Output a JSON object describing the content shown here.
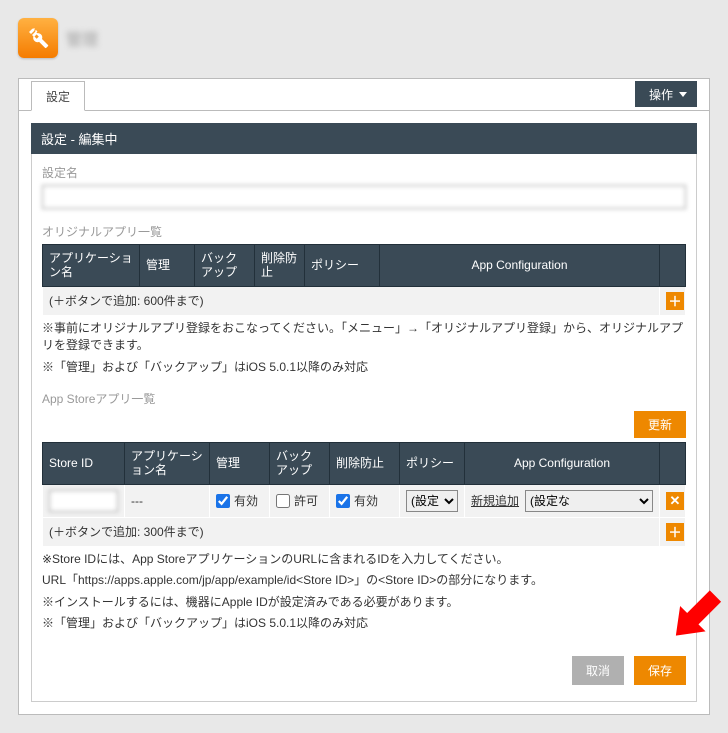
{
  "logo": {
    "text": "管理"
  },
  "tab": {
    "label": "設定"
  },
  "ops_button": {
    "label": "操作"
  },
  "title_bar": "設定 - 編集中",
  "setting_name": {
    "label": "設定名",
    "value": "　　　"
  },
  "original_apps": {
    "section_label": "オリジナルアプリ一覧",
    "headers": {
      "app_name": "アプリケーション名",
      "manage": "管理",
      "backup": "バックアップ",
      "prevent_delete": "削除防止",
      "policy": "ポリシー",
      "app_config": "App Configuration",
      "action": ""
    },
    "add_hint": "(＋ボタンで追加: 600件まで)",
    "notes": [
      "※事前にオリジナルアプリ登録をおこなってください。「メニュー」→「オリジナルアプリ登録」から、オリジナルアプリを登録できます。",
      "※「管理」および「バックアップ」はiOS 5.0.1以降のみ対応"
    ]
  },
  "appstore_apps": {
    "section_label": "App Storeアプリ一覧",
    "update_btn": "更新",
    "headers": {
      "store_id": "Store ID",
      "app_name": "アプリケーション名",
      "manage": "管理",
      "backup": "バックアップ",
      "prevent_delete": "削除防止",
      "policy": "ポリシー",
      "app_config": "App Configuration",
      "action": ""
    },
    "row": {
      "store_id": "",
      "app_name": "---",
      "manage": {
        "label": "有効",
        "checked": true
      },
      "backup": {
        "label": "許可",
        "checked": false
      },
      "prevent_delete": {
        "label": "有効",
        "checked": true
      },
      "policy_selected": "(設定",
      "new_add": "新規追加",
      "config_selected": "(設定な"
    },
    "add_hint": "(＋ボタンで追加: 300件まで)",
    "notes": [
      "※Store IDには、App StoreアプリケーションのURLに含まれるIDを入力してください。",
      "URL「https://apps.apple.com/jp/app/example/id<Store ID>」の<Store ID>の部分になります。",
      "※インストールするには、機器にApple IDが設定済みである必要があります。",
      "※「管理」および「バックアップ」はiOS 5.0.1以降のみ対応"
    ]
  },
  "buttons": {
    "cancel": "取消",
    "save": "保存"
  }
}
